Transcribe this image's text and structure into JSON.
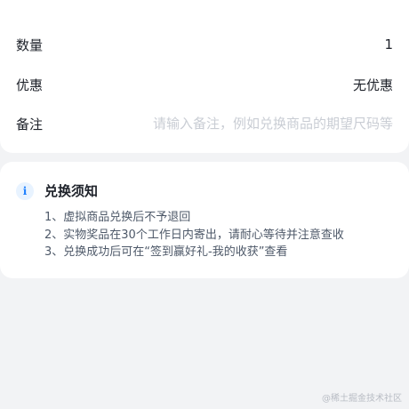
{
  "detail": {
    "quantity": {
      "label": "数量",
      "value": "1"
    },
    "discount": {
      "label": "优惠",
      "value": "无优惠"
    },
    "remark": {
      "label": "备注",
      "placeholder": "请输入备注，例如兑换商品的期望尺码等"
    }
  },
  "notice": {
    "icon": "info-icon",
    "icon_glyph": "i",
    "title": "兑换须知",
    "items": [
      "1、虚拟商品兑换后不予退回",
      "2、实物奖品在30个工作日内寄出，请耐心等待并注意查收",
      "3、兑换成功后可在“签到赢好礼-我的收获”查看"
    ]
  },
  "watermark": "@稀土掘金技术社区",
  "colors": {
    "background": "#f2f3f5",
    "card": "#ffffff",
    "accent": "#1e80ff",
    "placeholder": "#c9cdd4"
  }
}
